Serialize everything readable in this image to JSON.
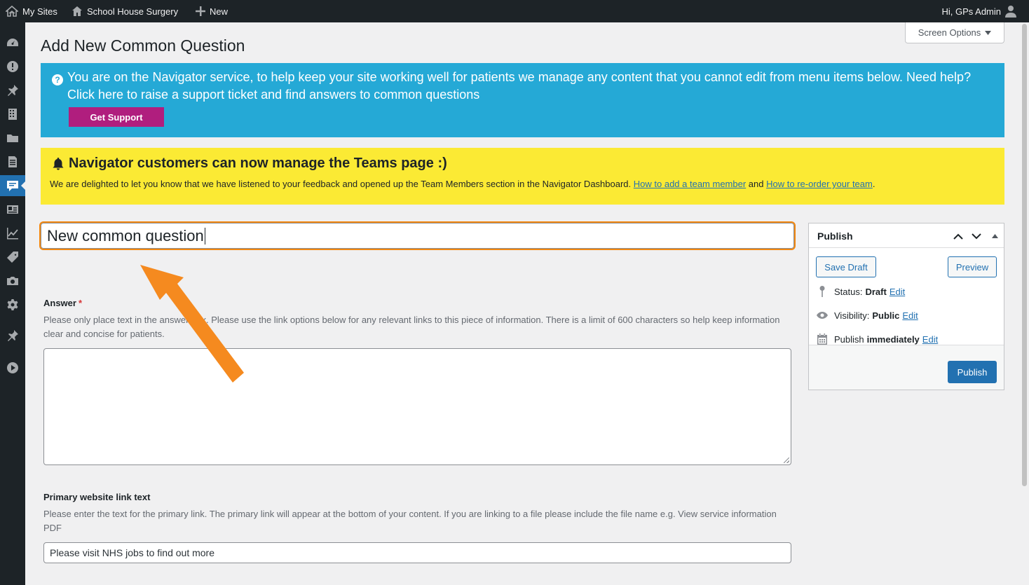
{
  "adminbar": {
    "my_sites": "My Sites",
    "site_name": "School House Surgery",
    "new_label": "New",
    "greeting": "Hi, GPs Admin"
  },
  "sidemenu": {
    "icons": [
      "dashboard-icon",
      "alert-icon",
      "pin-icon",
      "building-icon",
      "folder-icon",
      "page-icon",
      "comments-icon",
      "id-card-icon",
      "chart-icon",
      "tag-icon",
      "camera-icon",
      "settings-icon",
      "pin-icon",
      "play-icon"
    ],
    "active": "comments-icon"
  },
  "screen_options": "Screen Options",
  "page_title": "Add New Common Question",
  "support_banner": {
    "message": "You are on the Navigator service, to help keep your site working well for patients we manage any content that you cannot edit from menu items below. Need help? Click here to raise a support ticket and find answers to common questions",
    "button": "Get Support",
    "color": "#25a9d6",
    "button_color": "#b01e7e"
  },
  "teams_banner": {
    "title": "Navigator customers can now manage the Teams page :)",
    "body_start": "We are delighted to let you know that we have listened to your feedback and opened up the Team Members section in the Navigator Dashboard.",
    "link1": "How to add a team member",
    "and": "and",
    "link2": "How to re-order your team",
    "end": ".",
    "color": "#fbea34"
  },
  "title_field": {
    "value": "New common question",
    "focus_color": "#f2870f"
  },
  "answer": {
    "label": "Answer",
    "required": "*",
    "description": "Please only place text in the answer box. Please use the link options below for any relevant links to this piece of information. There is a limit of 600 characters so help keep information clear and concise for patients.",
    "value": ""
  },
  "primary_link": {
    "label": "Primary website link text",
    "description": "Please enter the text for the primary link. The primary link will appear at the bottom of your content. If you are linking to a file please include the file name e.g. View service information PDF",
    "placeholder": "Please visit NHS jobs to find out more"
  },
  "publish": {
    "title": "Publish",
    "save_draft": "Save Draft",
    "preview": "Preview",
    "status_label": "Status:",
    "status_value": "Draft",
    "visibility_label": "Visibility:",
    "visibility_value": "Public",
    "publish_label": "Publish",
    "publish_value": "immediately",
    "edit": "Edit",
    "button": "Publish",
    "primary_color": "#2271b1"
  },
  "annotation": {
    "arrow_color": "#f58a1f"
  }
}
